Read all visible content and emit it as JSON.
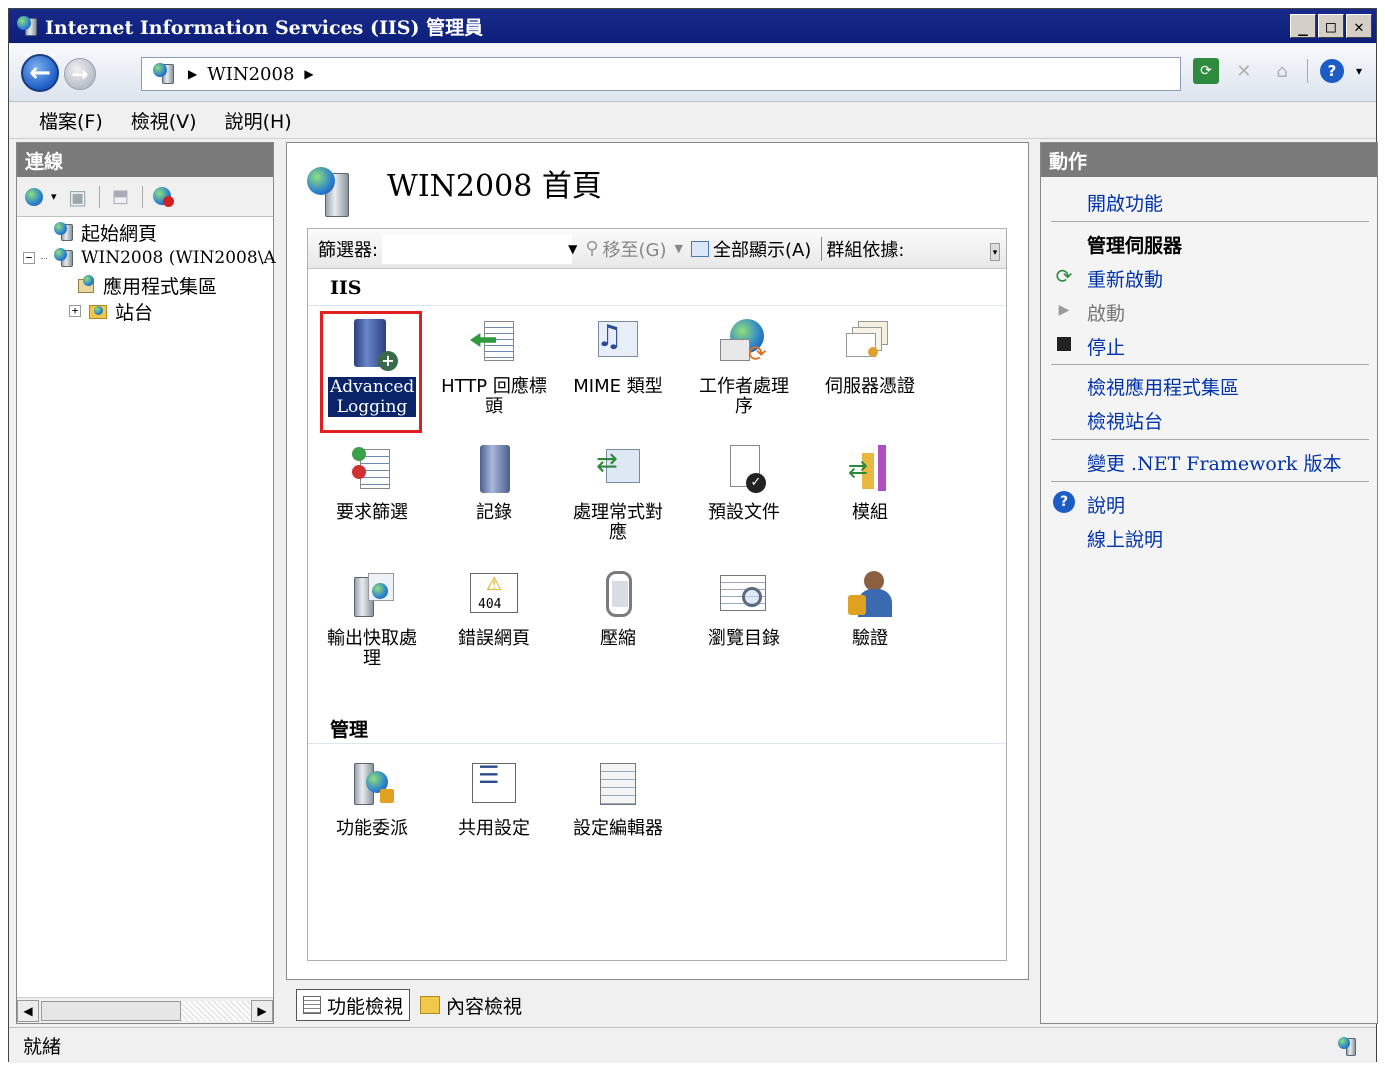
{
  "window": {
    "title": "Internet Information Services (IIS) 管理員"
  },
  "address": {
    "path_segments": [
      "WIN2008"
    ]
  },
  "menu": {
    "items": [
      "檔案(F)",
      "檢視(V)",
      "說明(H)"
    ]
  },
  "connections": {
    "header": "連線",
    "tree": [
      {
        "label": "起始網頁",
        "level": 1,
        "expander": ""
      },
      {
        "label": "WIN2008 (WIN2008\\A",
        "level": 0,
        "expander": "−"
      },
      {
        "label": "應用程式集區",
        "level": 2,
        "expander": ""
      },
      {
        "label": "站台",
        "level": 2,
        "expander": "+"
      }
    ]
  },
  "center": {
    "title": "WIN2008 首頁",
    "filter": {
      "label": "篩選器:",
      "goto": "移至(G)",
      "show_all": "全部顯示(A)",
      "group_by": "群組依據:"
    },
    "groups": [
      {
        "title": "IIS",
        "features": [
          {
            "label": "Advanced Logging",
            "icon": "advanced-logging-icon",
            "selected": true
          },
          {
            "label": "HTTP 回應標頭",
            "icon": "http-headers-icon"
          },
          {
            "label": "MIME 類型",
            "icon": "mime-types-icon"
          },
          {
            "label": "工作者處理序",
            "icon": "worker-process-icon"
          },
          {
            "label": "伺服器憑證",
            "icon": "server-certificates-icon"
          },
          {
            "label": "要求篩選",
            "icon": "request-filtering-icon"
          },
          {
            "label": "記錄",
            "icon": "logging-icon"
          },
          {
            "label": "處理常式對應",
            "icon": "handler-mappings-icon"
          },
          {
            "label": "預設文件",
            "icon": "default-document-icon"
          },
          {
            "label": "模組",
            "icon": "modules-icon"
          },
          {
            "label": "輸出快取處理",
            "icon": "output-caching-icon"
          },
          {
            "label": "錯誤網頁",
            "icon": "error-pages-icon"
          },
          {
            "label": "壓縮",
            "icon": "compression-icon"
          },
          {
            "label": "瀏覽目錄",
            "icon": "directory-browsing-icon"
          },
          {
            "label": "驗證",
            "icon": "authentication-icon"
          }
        ]
      },
      {
        "title": "管理",
        "features": [
          {
            "label": "功能委派",
            "icon": "feature-delegation-icon"
          },
          {
            "label": "共用設定",
            "icon": "shared-configuration-icon"
          },
          {
            "label": "設定編輯器",
            "icon": "configuration-editor-icon"
          }
        ]
      }
    ],
    "error_page_code": "404"
  },
  "view_tabs": {
    "features_view": "功能檢視",
    "content_view": "內容檢視"
  },
  "actions": {
    "header": "動作",
    "open_feature": "開啟功能",
    "manage_server": "管理伺服器",
    "restart": "重新啟動",
    "start": "啟動",
    "stop": "停止",
    "view_app_pools": "檢視應用程式集區",
    "view_sites": "檢視站台",
    "change_framework": "變更 .NET Framework 版本",
    "help": "說明",
    "online_help": "線上說明"
  },
  "status": {
    "text": "就緒"
  },
  "colors": {
    "title_bar": "#0a1f7a",
    "selected_label": "#0a246a",
    "highlight_border": "#e02020",
    "link": "#0033aa"
  }
}
